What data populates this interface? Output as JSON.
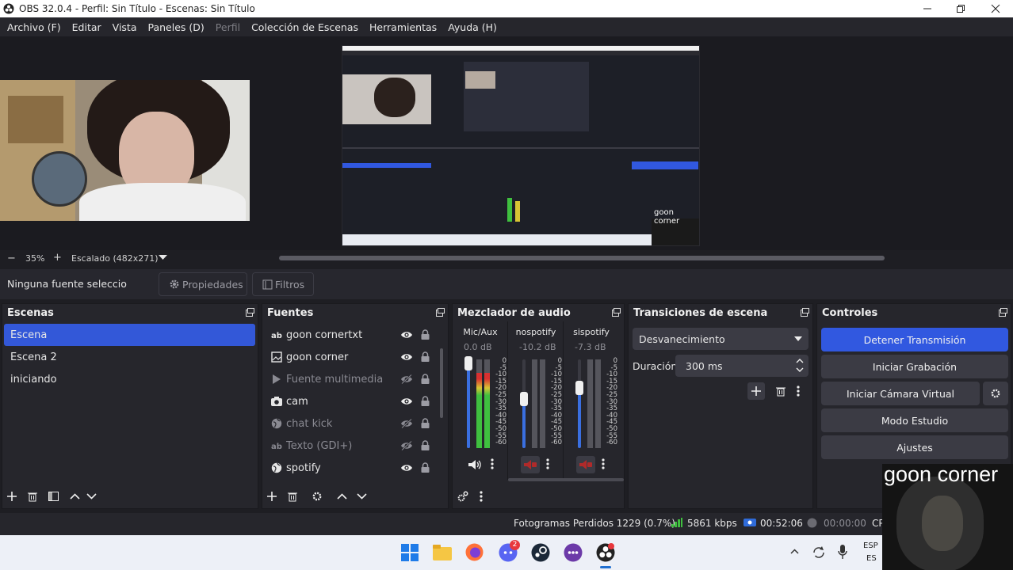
{
  "window": {
    "title": "OBS 32.0.4 - Perfil: Sin Título - Escenas: Sin Título"
  },
  "menu": [
    {
      "label": "Archivo (F)",
      "enabled": true
    },
    {
      "label": "Editar",
      "enabled": true
    },
    {
      "label": "Vista",
      "enabled": true
    },
    {
      "label": "Paneles (D)",
      "enabled": true
    },
    {
      "label": "Perfil",
      "enabled": false
    },
    {
      "label": "Colección de Escenas",
      "enabled": true
    },
    {
      "label": "Herramientas",
      "enabled": true
    },
    {
      "label": "Ayuda (H)",
      "enabled": true
    }
  ],
  "preview": {
    "zoom_minus": "−",
    "zoom": "35%",
    "zoom_plus": "+",
    "scale": "Escalado (482x271)",
    "overlay_text_small": "goon corner"
  },
  "source_bar": {
    "label": "Ninguna fuente seleccionada",
    "properties": "Propiedades",
    "filters": "Filtros"
  },
  "scenes": {
    "title": "Escenas",
    "items": [
      "Escena",
      "Escena 2",
      "iniciando"
    ],
    "selected": 0
  },
  "sources": {
    "title": "Fuentes",
    "items": [
      {
        "label": "goon cornertxt",
        "type": "text-icon",
        "visible": true
      },
      {
        "label": "goon corner",
        "type": "image-icon",
        "visible": true
      },
      {
        "label": "Fuente multimedia",
        "type": "play-icon",
        "visible": false
      },
      {
        "label": "cam",
        "type": "camera-icon",
        "visible": true
      },
      {
        "label": "chat kick",
        "type": "globe-icon",
        "visible": false
      },
      {
        "label": "Texto (GDI+)",
        "type": "text-icon",
        "visible": false
      },
      {
        "label": "spotify",
        "type": "globe-icon",
        "visible": true
      }
    ]
  },
  "mixer": {
    "title": "Mezclador de audio",
    "channels": [
      {
        "name": "Mic/Aux",
        "db": "0.0 dB",
        "level": 0.85,
        "volume": 1.0,
        "muted": false
      },
      {
        "name": "nospotify",
        "db": "-10.2 dB",
        "level": 0,
        "volume": 0.6,
        "muted": true
      },
      {
        "name": "sispotify",
        "db": "-7.3 dB",
        "level": 0,
        "volume": 0.72,
        "muted": true
      }
    ],
    "scale": [
      "0",
      "-5",
      "-10",
      "-15",
      "-20",
      "-25",
      "-30",
      "-35",
      "-40",
      "-45",
      "-50",
      "-55",
      "-60"
    ]
  },
  "transitions": {
    "title": "Transiciones de escena",
    "selected": "Desvanecimiento",
    "duration_label": "Duración",
    "duration": "300 ms"
  },
  "controls": {
    "title": "Controles",
    "stop_stream": "Detener Transmisión",
    "start_recording": "Iniciar Grabación",
    "start_virtual_cam": "Iniciar Cámara Virtual",
    "studio_mode": "Modo Estudio",
    "settings": "Ajustes"
  },
  "status": {
    "dropped_frames": "Fotogramas Perdidos 1229 (0.7%)",
    "bitrate": "5861 kbps",
    "stream_time": "00:52:06",
    "record_time": "00:00:00",
    "cpu": "CP"
  },
  "overlay": {
    "text": "goon corner"
  },
  "taskbar": {
    "chat_badge": "2",
    "lang": "ESP",
    "region": "ES"
  },
  "colors": {
    "accent": "#3158e0",
    "meter_green": "#3fbf3f",
    "meter_yellow": "#d8c434",
    "meter_red": "#d83030",
    "mute_red": "#b02a2a"
  }
}
